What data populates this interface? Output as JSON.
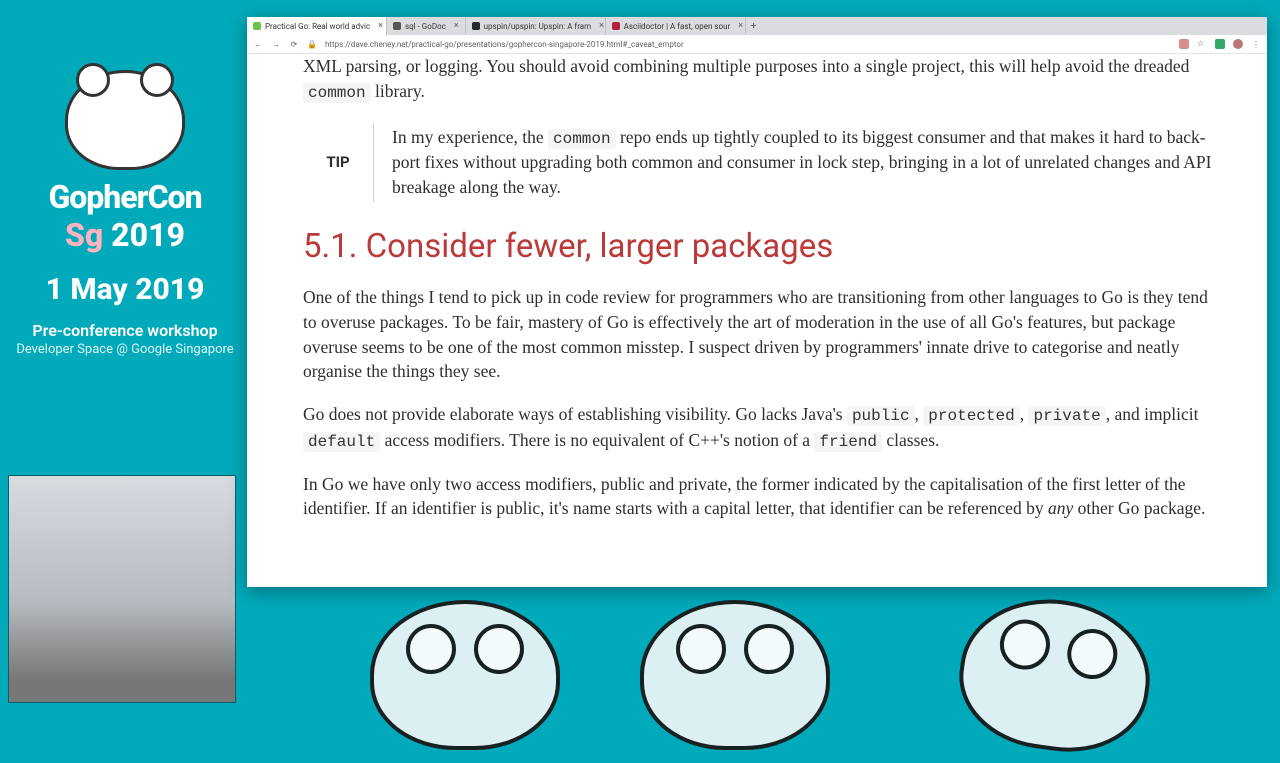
{
  "brand": {
    "line1": "GopherCon",
    "line2_sg": "Sg",
    "line2_yr": "2019",
    "date": "1 May 2019",
    "sub": "Pre-conference workshop",
    "sub2": "Developer Space @ Google Singapore"
  },
  "browser": {
    "tabs": [
      {
        "label": "Practical Go: Real world advic",
        "favicon": "#6cc24a",
        "active": true
      },
      {
        "label": "sql - GoDoc",
        "favicon": "#555",
        "active": false
      },
      {
        "label": "upspin/upspin: Upspin: A fram",
        "favicon": "#24292e",
        "active": false
      },
      {
        "label": "Asciidoctor | A fast, open sour",
        "favicon": "#b5213b",
        "active": false
      }
    ],
    "url": "https://dave.cheney.net/practical-go/presentations/gophercon-singapore-2019.html#_caveat_emptor"
  },
  "doc": {
    "p1_pre": "XML parsing, or logging. You should avoid combining multiple purposes into a single project, this will help avoid the dreaded ",
    "p1_code": "common",
    "p1_post": " library.",
    "tip_label": "TIP",
    "tip_pre": "In my experience, the ",
    "tip_code": "common",
    "tip_post": " repo ends up tightly coupled to its biggest consumer and that makes it hard to back-port fixes without upgrading both common and consumer in lock step, bringing in a lot of unrelated changes and API breakage along the way.",
    "h2": "5.1. Consider fewer, larger packages",
    "p2": "One of the things I tend to pick up in code review for programmers who are transitioning from other languages to Go is they tend to overuse packages. To be fair, mastery of Go is effectively the art of moderation in the use of all Go's features, but package overuse seems to be one of the most common misstep. I suspect driven by programmers' innate drive to categorise and neatly organise the things they see.",
    "p3_pre": "Go does not provide elaborate ways of establishing visibility. Go lacks Java's ",
    "p3_code1": "public",
    "p3_sep1": ", ",
    "p3_code2": "protected",
    "p3_sep2": ", ",
    "p3_code3": "private",
    "p3_mid": ", and implicit ",
    "p3_code4": "default",
    "p3_mid2": " access modifiers. There is no equivalent of C++'s notion of a ",
    "p3_code5": "friend",
    "p3_post": " classes.",
    "p4_pre": "In Go we have only two access modifiers, public and private, the former indicated by the capitalisation of the first letter of the identifier. If an identifier is public, it's name starts with a capital letter, that identifier can be referenced by ",
    "p4_em": "any",
    "p4_post": " other Go package."
  }
}
